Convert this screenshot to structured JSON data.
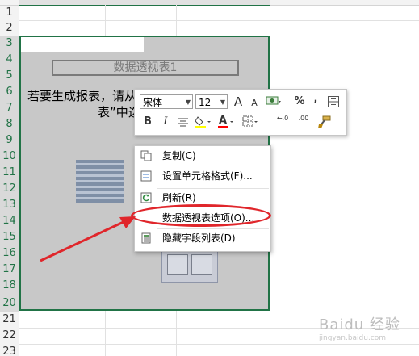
{
  "sheet": {
    "row_numbers": [
      "1",
      "2",
      "3",
      "4",
      "5",
      "6",
      "7",
      "8",
      "9",
      "10",
      "11",
      "12",
      "13",
      "14",
      "15",
      "16",
      "17",
      "18",
      "19",
      "20",
      "21",
      "22",
      "23"
    ]
  },
  "pivot": {
    "name": "数据透视表1",
    "message_line1": "若要生成报表，请从“数据透视表字段列",
    "message_line2": "表”中选"
  },
  "mini_toolbar": {
    "font_name": "宋体",
    "font_size": "12",
    "grow_font": "A",
    "shrink_font": "A",
    "percent": "%",
    "comma": ",",
    "bold": "B",
    "italic": "I",
    "font_color_letter": "A",
    "inc_decimal": "←.0",
    "dec_decimal": ".00",
    "colors": {
      "highlight": "#ffff00",
      "font": "#ff0000"
    }
  },
  "context_menu": {
    "items": [
      {
        "label": "复制(C)",
        "icon": "copy-icon"
      },
      {
        "label": "设置单元格格式(F)...",
        "icon": "format-cells-icon"
      },
      {
        "label": "刷新(R)",
        "icon": "refresh-icon"
      },
      {
        "label": "数据透视表选项(O)...",
        "icon": "none"
      },
      {
        "label": "隐藏字段列表(D)",
        "icon": "field-list-icon"
      }
    ]
  },
  "annotation": {
    "arrow_color": "#e0262b",
    "ellipse_color": "#e0262b"
  },
  "watermark": {
    "text": "Baidu 经验",
    "sub": "jingyan.baidu.com"
  }
}
